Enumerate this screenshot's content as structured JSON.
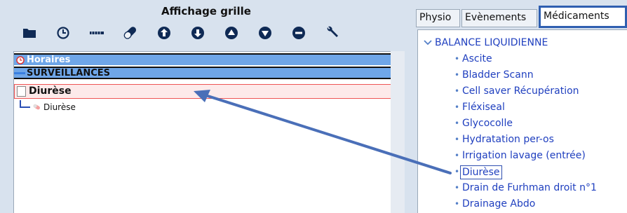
{
  "left_panel": {
    "title": "Affichage grille",
    "toolbar": [
      {
        "icon": "folder-icon"
      },
      {
        "icon": "clock-icon"
      },
      {
        "icon": "dotted-line-icon"
      },
      {
        "icon": "pill-icon"
      },
      {
        "icon": "arrow-up-circle-icon"
      },
      {
        "icon": "arrow-down-circle-icon"
      },
      {
        "icon": "triangle-up-circle-icon"
      },
      {
        "icon": "triangle-down-circle-icon"
      },
      {
        "icon": "minus-circle-icon"
      },
      {
        "icon": "wrench-icon"
      }
    ],
    "grid": {
      "horaires": "Horaires",
      "surveillances": "SURVEILLANCES",
      "diurese_header": "Diurèse",
      "diurese_item": "Diurèse"
    }
  },
  "right_panel": {
    "tabs": [
      "Physio",
      "Evènements",
      "Médicaments"
    ],
    "active_tab": "Médicaments",
    "tree": {
      "root": "BALANCE LIQUIDIENNE",
      "items": [
        "Ascite",
        "Bladder Scann",
        "Cell saver Récupération",
        "Fléxiseal",
        "Glycocolle",
        "Hydratation per-os",
        "Irrigation lavage (entrée)",
        "Diurèse",
        "Drain de Furhman droit n°1",
        "Drainage Abdo"
      ],
      "selected_item": "Diurèse"
    }
  },
  "colors": {
    "header_row_bg": "#6fa6e8",
    "tree_text": "#1f3fbf",
    "active_tab_border": "#2f5fb0",
    "arrow": "#4a6fb8",
    "highlight_border": "#ee5555"
  }
}
